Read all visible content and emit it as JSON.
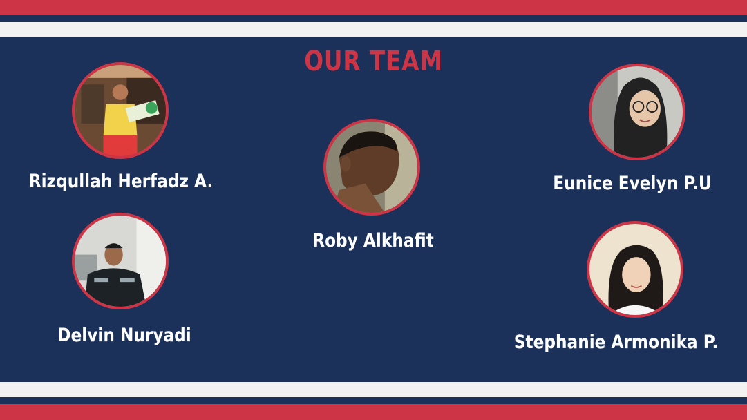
{
  "slide": {
    "title": "OUR TEAM",
    "colors": {
      "background": "#1b3159",
      "accent": "#cd3547",
      "stripe_light": "#f2f2f2",
      "text": "#ffffff"
    }
  },
  "members": {
    "rizqullah": {
      "name": "Rizqullah Herfadz A.",
      "photo": "member-photo"
    },
    "roby": {
      "name": "Roby Alkhafit",
      "photo": "member-photo"
    },
    "eunice": {
      "name": "Eunice Evelyn P.U",
      "photo": "member-photo"
    },
    "delvin": {
      "name": "Delvin Nuryadi",
      "photo": "member-photo"
    },
    "stephanie": {
      "name": "Stephanie Armonika P.",
      "photo": "member-photo"
    }
  }
}
